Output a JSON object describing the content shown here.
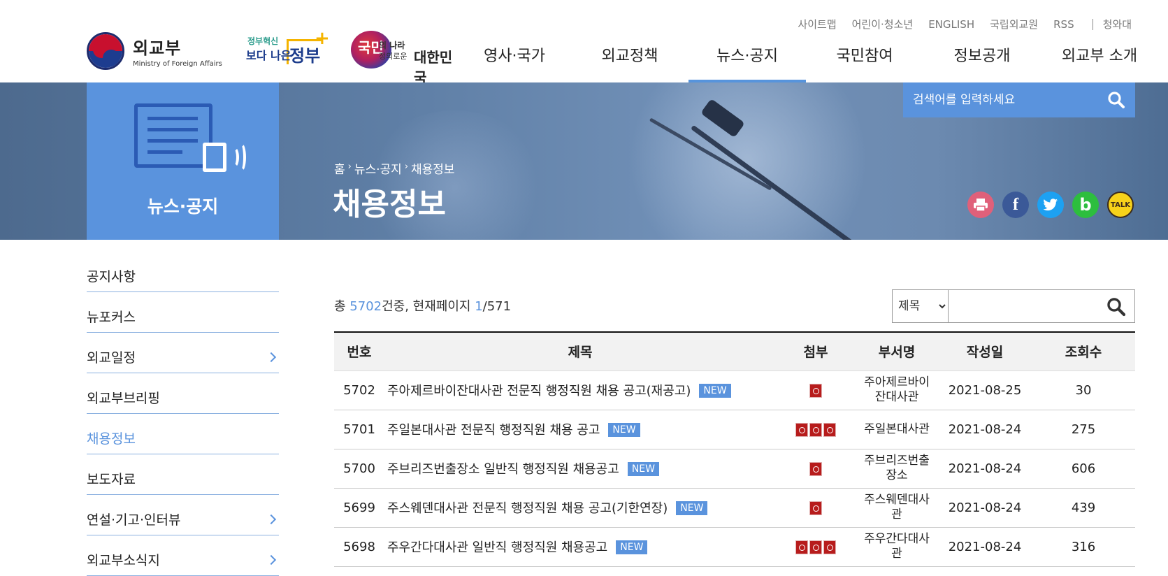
{
  "utility_links": [
    "사이트맵",
    "어린이·청소년",
    "ENGLISH",
    "국립외교원",
    "RSS"
  ],
  "utility_last": "청와대",
  "logo": {
    "ko": "외교부",
    "en": "Ministry of Foreign Affairs"
  },
  "gov_logo": {
    "line1": "정부혁신",
    "line2": "보다 나은",
    "line3": "정부",
    "plus": "+"
  },
  "people_logo": {
    "a": "국민",
    "b": "의 나라",
    "c": "정의로운",
    "d": "대한민국"
  },
  "gnb": [
    "영사·국가",
    "외교정책",
    "뉴스·공지",
    "국민참여",
    "정보공개",
    "외교부 소개"
  ],
  "gnb_active_index": 2,
  "side_title": "뉴스·공지",
  "breadcrumb": [
    "홈",
    "뉴스·공지",
    "채용정보"
  ],
  "page_title": "채용정보",
  "search": {
    "placeholder": "검색어를 입력하세요"
  },
  "sns": [
    {
      "name": "print-icon",
      "color": "#e0607a"
    },
    {
      "name": "facebook-icon",
      "color": "#3b5998",
      "glyph": "f"
    },
    {
      "name": "twitter-icon",
      "color": "#1da1f2"
    },
    {
      "name": "band-icon",
      "color": "#2dbe3e",
      "glyph": "b"
    },
    {
      "name": "kakaotalk-icon",
      "color": "#f7d21a",
      "glyph": "TALK"
    }
  ],
  "lnb": [
    {
      "label": "공지사항",
      "has_sub": false
    },
    {
      "label": "뉴포커스",
      "has_sub": false
    },
    {
      "label": "외교일정",
      "has_sub": true
    },
    {
      "label": "외교부브리핑",
      "has_sub": false
    },
    {
      "label": "채용정보",
      "has_sub": false,
      "active": true
    },
    {
      "label": "보도자료",
      "has_sub": false
    },
    {
      "label": "연설·기고·인터뷰",
      "has_sub": true
    },
    {
      "label": "외교부소식지",
      "has_sub": true
    }
  ],
  "total": {
    "prefix": "총 ",
    "count": "5702",
    "mid": "건중, 현재페이지 ",
    "page": "1",
    "pages": "/571"
  },
  "board_search": {
    "option": "제목"
  },
  "columns": [
    "번호",
    "제목",
    "첨부",
    "부서명",
    "작성일",
    "조회수"
  ],
  "badge_new": "NEW",
  "rows": [
    {
      "no": "5702",
      "title": "주아제르바이잔대사관 전문직 행정직원 채용 공고(재공고)",
      "attachments": 1,
      "dept": [
        "주아제르바이",
        "잔대사관"
      ],
      "date": "2021-08-25",
      "views": "30"
    },
    {
      "no": "5701",
      "title": "주일본대사관 전문직 행정직원 채용 공고",
      "attachments": 3,
      "dept": [
        "주일본대사관"
      ],
      "date": "2021-08-24",
      "views": "275"
    },
    {
      "no": "5700",
      "title": "주브리즈번출장소 일반직 행정직원 채용공고",
      "attachments": 1,
      "dept": [
        "주브리즈번출",
        "장소"
      ],
      "date": "2021-08-24",
      "views": "606"
    },
    {
      "no": "5699",
      "title": "주스웨덴대사관 전문직 행정직원 채용 공고(기한연장)",
      "attachments": 1,
      "dept": [
        "주스웨덴대사",
        "관"
      ],
      "date": "2021-08-24",
      "views": "439"
    },
    {
      "no": "5698",
      "title": "주우간다대사관 일반직 행정직원 채용공고",
      "attachments": 3,
      "dept": [
        "주우간다대사",
        "관"
      ],
      "date": "2021-08-24",
      "views": "316"
    }
  ]
}
